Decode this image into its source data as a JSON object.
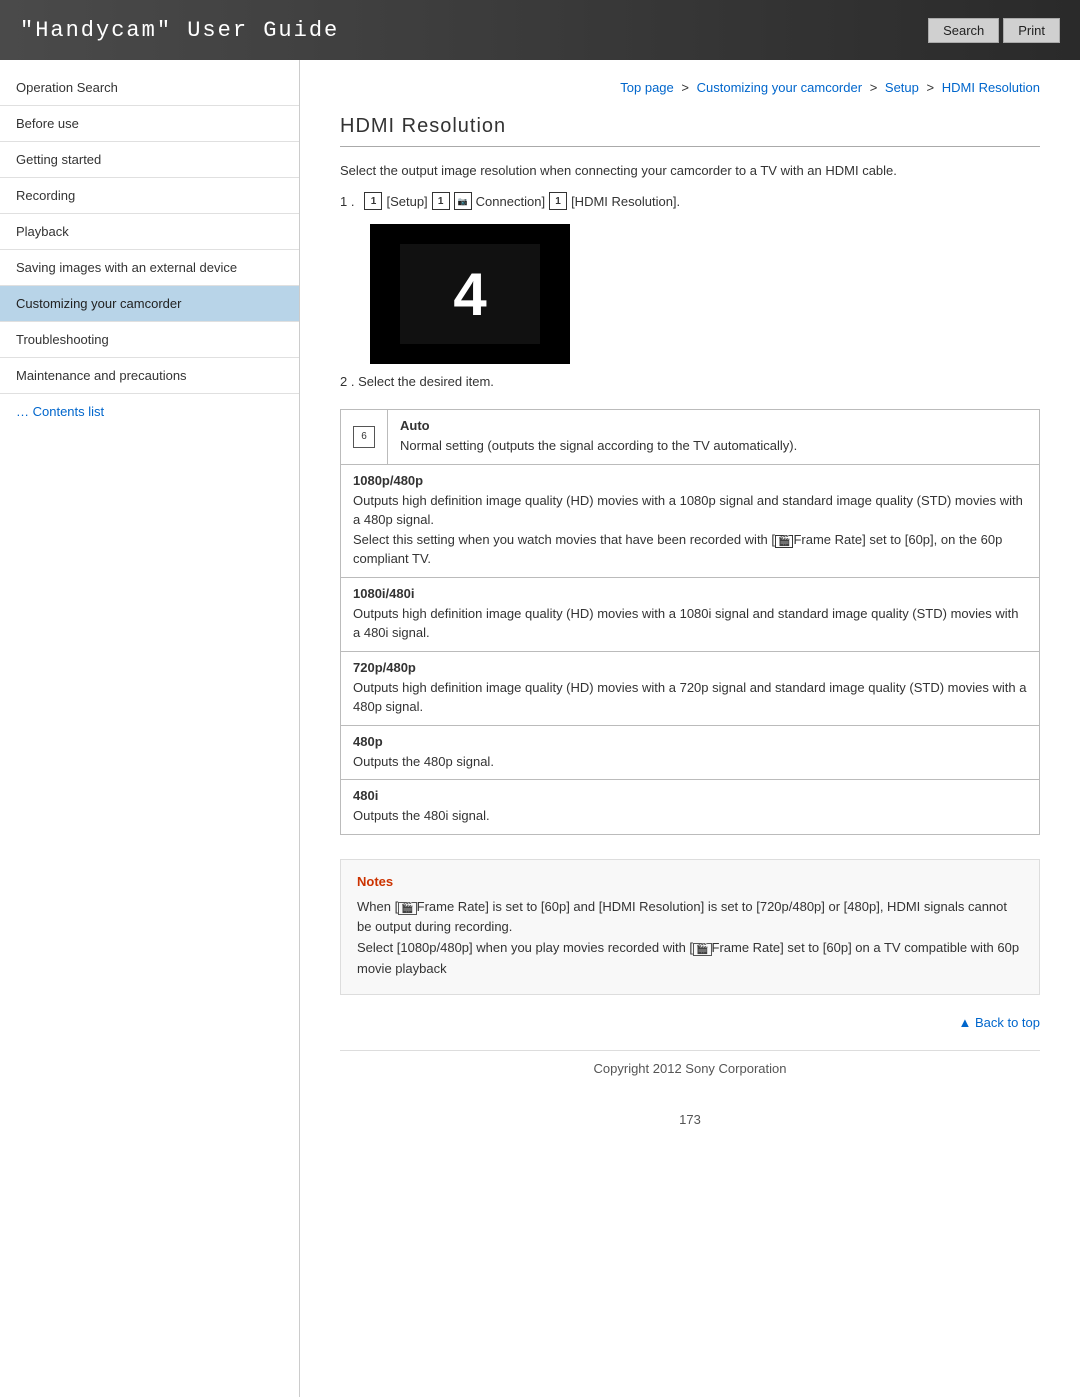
{
  "header": {
    "title": "\"Handycam\" User Guide",
    "search_label": "Search",
    "print_label": "Print"
  },
  "breadcrumb": {
    "top_page": "Top page",
    "customizing": "Customizing your camcorder",
    "setup": "Setup",
    "current": "HDMI Resolution"
  },
  "sidebar": {
    "items": [
      {
        "id": "operation-search",
        "label": "Operation Search",
        "active": false
      },
      {
        "id": "before-use",
        "label": "Before use",
        "active": false
      },
      {
        "id": "getting-started",
        "label": "Getting started",
        "active": false
      },
      {
        "id": "recording",
        "label": "Recording",
        "active": false
      },
      {
        "id": "playback",
        "label": "Playback",
        "active": false
      },
      {
        "id": "saving-images",
        "label": "Saving images with an external device",
        "active": false
      },
      {
        "id": "customizing",
        "label": "Customizing your camcorder",
        "active": true
      },
      {
        "id": "troubleshooting",
        "label": "Troubleshooting",
        "active": false
      },
      {
        "id": "maintenance",
        "label": "Maintenance and precautions",
        "active": false
      }
    ],
    "contents_link": "… Contents list"
  },
  "main": {
    "page_title": "HDMI Resolution",
    "intro_text": "Select the output image resolution when connecting your camcorder to a TV with an HDMI cable.",
    "step1": {
      "number": "1 .",
      "icon1": "1",
      "setup_label": "[Setup]",
      "icon2": "1",
      "icon3": "2",
      "connection_label": "Connection]",
      "icon4": "1",
      "resolution_label": "[HDMI Resolution]."
    },
    "step2_text": "2 .   Select the desired item.",
    "options": [
      {
        "has_icon": true,
        "icon_text": "6",
        "name": "Auto",
        "desc": "Normal setting (outputs the signal according to the TV automatically)."
      },
      {
        "has_icon": false,
        "name": "1080p/480p",
        "desc": "Outputs high definition image quality (HD) movies with a 1080p signal and standard image quality (STD) movies with a 480p signal.\nSelect this setting when you watch movies that have been recorded with [Frame Rate] set to [60p], on the 60p compliant TV."
      },
      {
        "has_icon": false,
        "name": "1080i/480i",
        "desc": "Outputs high definition image quality (HD) movies with a 1080i signal and standard image quality (STD) movies with a 480i signal."
      },
      {
        "has_icon": false,
        "name": "720p/480p",
        "desc": "Outputs high definition image quality (HD) movies with a 720p signal and standard image quality (STD) movies with a 480p signal."
      },
      {
        "has_icon": false,
        "name": "480p",
        "desc": "Outputs the 480p signal."
      },
      {
        "has_icon": false,
        "name": "480i",
        "desc": "Outputs the 480i signal."
      }
    ],
    "notes": {
      "title": "Notes",
      "lines": [
        "When [Frame Rate] is set to [60p] and [HDMI Resolution] is set to [720p/480p] or [480p], HDMI signals cannot be output during recording.",
        "Select [1080p/480p] when you play movies recorded with [Frame Rate] set to [60p] on a TV compatible with 60p movie playback"
      ]
    },
    "back_to_top": "▲ Back to top",
    "copyright": "Copyright 2012 Sony Corporation",
    "page_number": "173"
  }
}
